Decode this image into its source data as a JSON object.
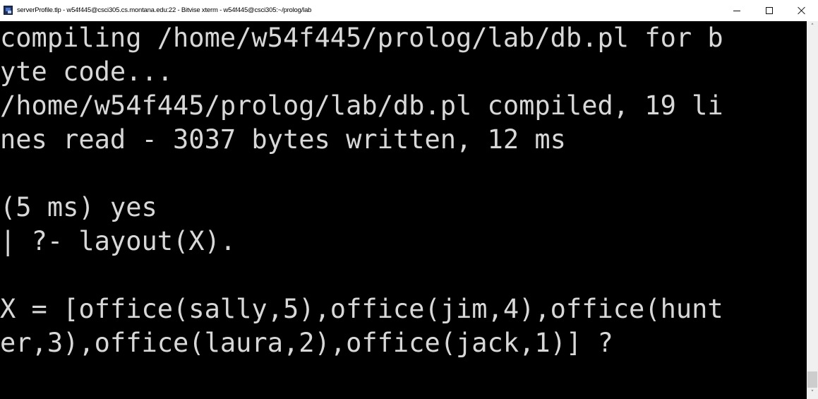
{
  "window": {
    "title": "serverProfile.tlp - w54f445@csci305.cs.montana.edu:22 - Bitvise xterm - w54f445@csci305:~/prolog/lab",
    "app_icon": "bitvise-terminal-icon",
    "controls": {
      "minimize_icon": "minimize-icon",
      "maximize_icon": "maximize-icon",
      "close_icon": "close-icon"
    }
  },
  "terminal": {
    "background": "#000000",
    "foreground": "#d8d8d8",
    "lines": [
      "compiling /home/w54f445/prolog/lab/db.pl for b",
      "yte code...",
      "/home/w54f445/prolog/lab/db.pl compiled, 19 li",
      "nes read - 3037 bytes written, 12 ms",
      "",
      "(5 ms) yes",
      "| ?- layout(X).",
      "",
      "X = [office(sally,5),office(jim,4),office(hunt",
      "er,3),office(laura,2),office(jack,1)] ?"
    ]
  },
  "scrollbar": {
    "up_arrow": "˄",
    "down_arrow": "˅"
  }
}
